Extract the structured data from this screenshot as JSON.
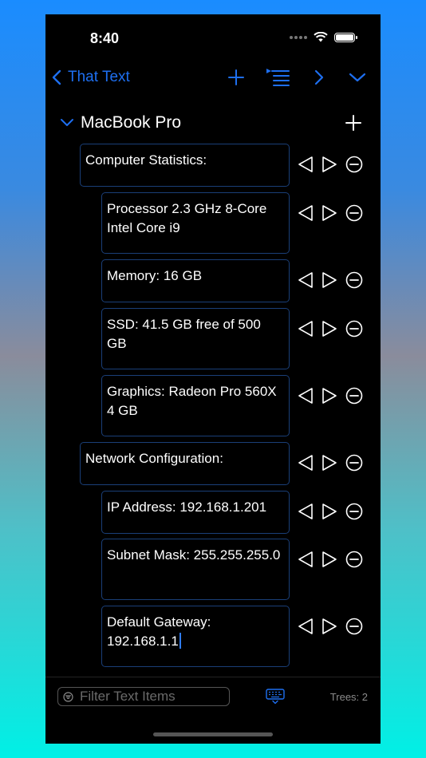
{
  "status": {
    "time": "8:40"
  },
  "nav": {
    "back_label": "That Text"
  },
  "tree": {
    "title": "MacBook Pro",
    "items": [
      {
        "text": "Computer Statistics:",
        "level": 0
      },
      {
        "text": "Processor 2.3 GHz 8-Core Intel Core i9",
        "level": 1
      },
      {
        "text": "Memory: 16 GB",
        "level": 1
      },
      {
        "text": "SSD: 41.5 GB free of 500 GB",
        "level": 1
      },
      {
        "text": "Graphics: Radeon Pro 560X 4 GB",
        "level": 1
      },
      {
        "text": "Network Configuration:",
        "level": 0
      },
      {
        "text": "IP Address: 192.168.1.201",
        "level": 1
      },
      {
        "text": "Subnet Mask: 255.255.255.0",
        "level": 1
      },
      {
        "text": "Default Gateway: 192.168.1.1",
        "level": 1,
        "editing": true
      }
    ]
  },
  "bottom": {
    "filter_placeholder": "Filter Text Items",
    "trees_count": "Trees: 2"
  },
  "colors": {
    "accent": "#1e6ff0",
    "item_border": "#1a3f78"
  }
}
